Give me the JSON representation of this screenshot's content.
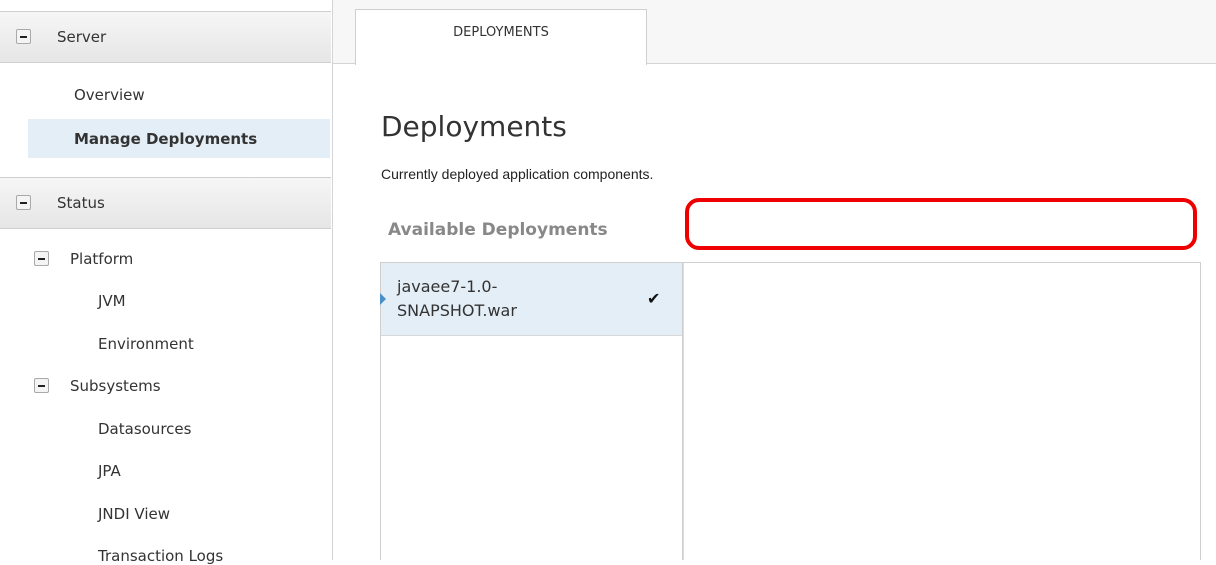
{
  "sidebar": {
    "server": {
      "label": "Server",
      "items": [
        "Overview",
        "Manage Deployments"
      ],
      "selected": "Manage Deployments"
    },
    "status": {
      "label": "Status",
      "platform": {
        "label": "Platform",
        "items": [
          "JVM",
          "Environment"
        ]
      },
      "subsystems": {
        "label": "Subsystems",
        "items": [
          "Datasources",
          "JPA",
          "JNDI View",
          "Transaction Logs"
        ]
      }
    }
  },
  "tabs": [
    "DEPLOYMENTS"
  ],
  "main": {
    "title": "Deployments",
    "description": "Currently deployed application components.",
    "available_label": "Available Deployments",
    "deployments": [
      {
        "name": "javaee7-1.0-SNAPSHOT.war",
        "enabled": true,
        "check_icon": "checkmark-icon"
      }
    ]
  },
  "colors": {
    "highlight": "#ee0000",
    "selection": "#e4eef6"
  }
}
